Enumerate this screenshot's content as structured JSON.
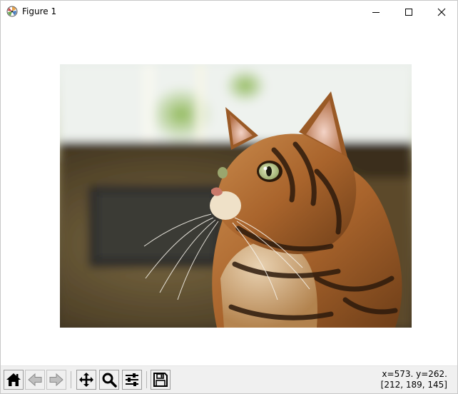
{
  "window": {
    "title": "Figure 1",
    "icon": "matplotlib-logo-icon",
    "controls": {
      "minimize": "minimize-icon",
      "maximize": "maximize-icon",
      "close": "close-icon"
    }
  },
  "figure": {
    "image_content": "photo of tabby bengal cat looking up",
    "background": "#ffffff"
  },
  "toolbar": {
    "tools": [
      {
        "name": "home",
        "icon": "home-icon"
      },
      {
        "name": "back",
        "icon": "back-arrow-icon"
      },
      {
        "name": "forward",
        "icon": "forward-arrow-icon"
      },
      {
        "name": "pan",
        "icon": "pan-move-icon"
      },
      {
        "name": "zoom",
        "icon": "zoom-magnifier-icon"
      },
      {
        "name": "configure-subplots",
        "icon": "sliders-icon"
      },
      {
        "name": "save",
        "icon": "floppy-disk-icon"
      }
    ],
    "coords_line1": "x=573. y=262.",
    "coords_line2": "[212, 189, 145]"
  }
}
